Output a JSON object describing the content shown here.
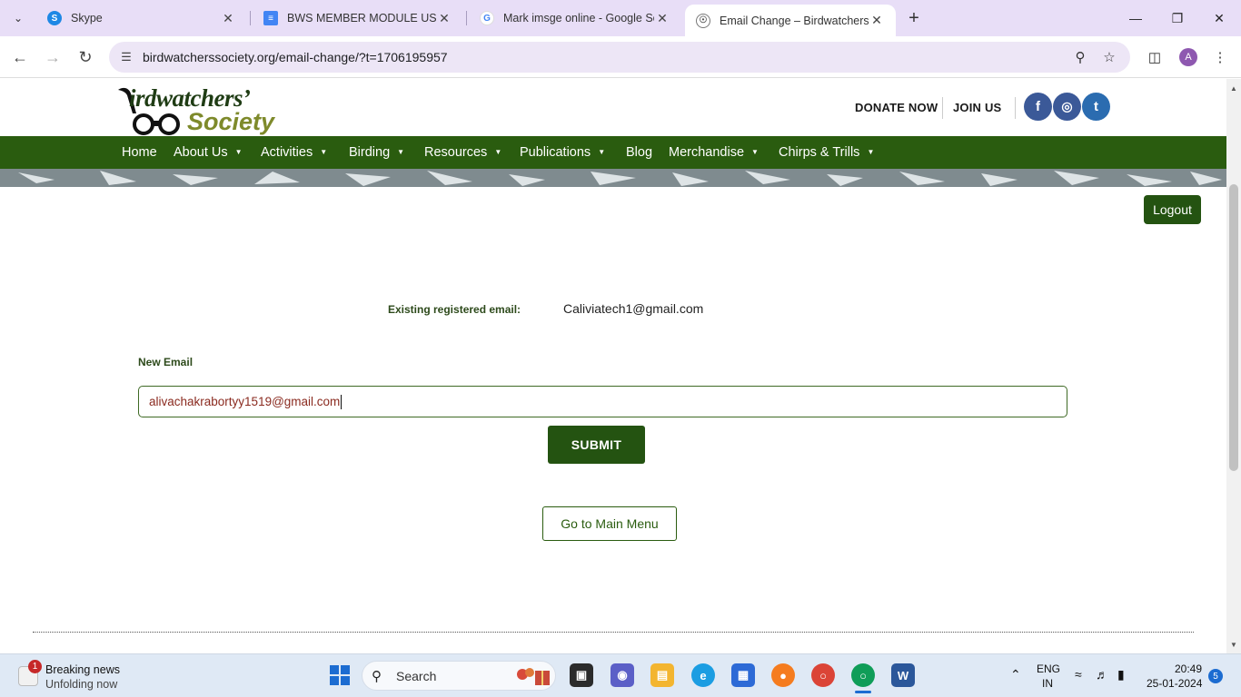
{
  "browser": {
    "tabs": [
      {
        "title": "Skype",
        "favicon": "skype-icon",
        "color": "#1e88e5"
      },
      {
        "title": "BWS MEMBER MODULE USER C",
        "favicon": "docs-icon",
        "color": "#4285f4"
      },
      {
        "title": "Mark imsge online - Google Sea",
        "favicon": "google-icon",
        "color": "#ea4335"
      },
      {
        "title": "Email Change – Birdwatchers So",
        "favicon": "globe-icon",
        "color": "#555555"
      }
    ],
    "url": "birdwatcherssociety.org/email-change/?t=1706195957",
    "profile_initial": "A"
  },
  "site": {
    "logo_line1": "irdwatchers’",
    "logo_line2": "Society",
    "donate": "DONATE NOW",
    "join": "JOIN US",
    "social": [
      "f",
      "◎",
      "t"
    ],
    "nav": [
      "Home",
      "About Us",
      "Activities",
      "Birding",
      "Resources",
      "Publications",
      "Blog",
      "Merchandise",
      "Chirps & Trills"
    ]
  },
  "form": {
    "logout": "Logout",
    "existing_label": "Existing registered email:",
    "existing_value": "Caliviatech1@gmail.com",
    "new_email_label": "New Email",
    "new_email_value": "alivachakrabortyy1519@gmail.com",
    "submit": "SUBMIT",
    "main_menu": "Go to Main Menu"
  },
  "taskbar": {
    "news_title": "Breaking news",
    "news_sub": "Unfolding now",
    "news_count": "1",
    "search": "Search",
    "lang1": "ENG",
    "lang2": "IN",
    "time": "20:49",
    "date": "25-01-2024",
    "notifications": "5"
  },
  "colors": {
    "nav_green": "#2a5c0f",
    "button_green": "#245311",
    "olive": "#7e8a2b"
  }
}
